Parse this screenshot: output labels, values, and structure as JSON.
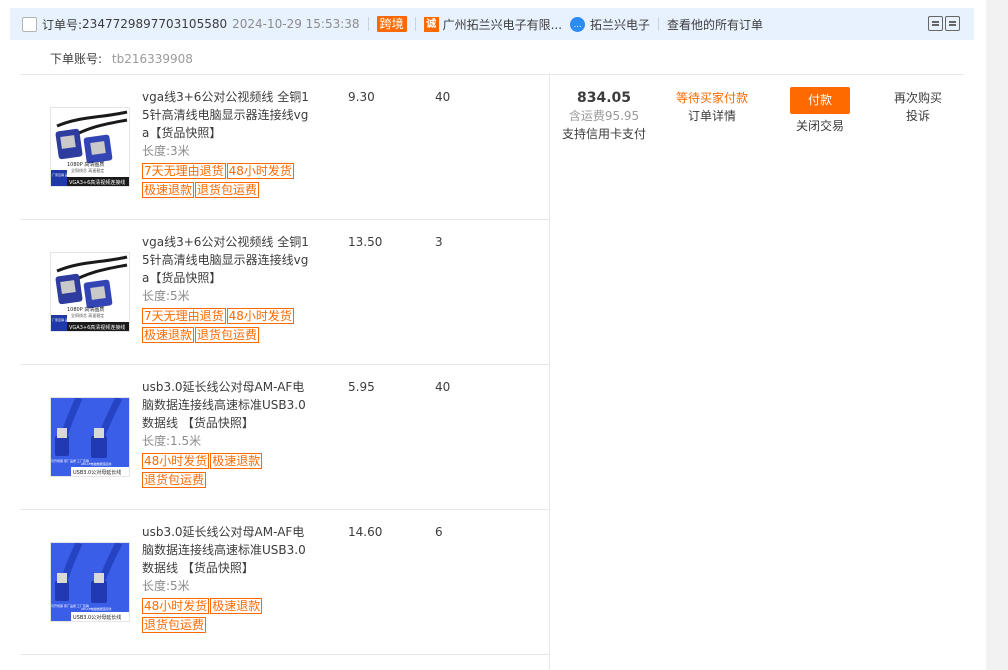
{
  "header": {
    "order_no_label": "订单号:",
    "order_no": "2347729897703105580",
    "order_time": "2024-10-29 15:53:38",
    "crossborder_tag": "跨境",
    "shop_name": "广州拓兰兴电子有限...",
    "chat_name": "拓兰兴电子",
    "all_orders_link": "查看他的所有订单"
  },
  "account": {
    "label": "下单账号:",
    "value": "tb216339908"
  },
  "items": [
    {
      "title": "vga线3+6公对公视频线 全铜15针高清线电脑显示器连接线vga",
      "snapshot": "【货品快照】",
      "spec": "长度:3米",
      "price": "9.30",
      "qty": "40",
      "badges": [
        "7天无理由退货",
        "48小时发货",
        "极速退款",
        "退货包运费"
      ],
      "image_kind": "vga"
    },
    {
      "title": "vga线3+6公对公视频线 全铜15针高清线电脑显示器连接线vga",
      "snapshot": "【货品快照】",
      "spec": "长度:5米",
      "price": "13.50",
      "qty": "3",
      "badges": [
        "7天无理由退货",
        "48小时发货",
        "极速退款",
        "退货包运费"
      ],
      "image_kind": "vga"
    },
    {
      "title": "usb3.0延长线公对母AM-AF电脑数据连接线高速标准USB3.0数据线",
      "snapshot": " 【货品快照】",
      "spec": "长度:1.5米",
      "price": "5.95",
      "qty": "40",
      "badges": [
        "48小时发货",
        "极速退款",
        "退货包运费"
      ],
      "image_kind": "usb"
    },
    {
      "title": "usb3.0延长线公对母AM-AF电脑数据连接线高速标准USB3.0数据线",
      "snapshot": " 【货品快照】",
      "spec": "长度:5米",
      "price": "14.60",
      "qty": "6",
      "badges": [
        "48小时发货",
        "极速退款",
        "退货包运费"
      ],
      "image_kind": "usb"
    }
  ],
  "summary": {
    "total": "834.05",
    "shipping": "含运费95.95",
    "credit": "支持信用卡支付",
    "status": "等待买家付款",
    "detail_link": "订单详情",
    "pay_button": "付款",
    "close_link": "关闭交易",
    "rebuy_link": "再次购买",
    "complain_link": "投诉"
  },
  "images": {
    "vga_line1": "1080P 高清画质",
    "vga_line2": "全铜线芯 高速稳定",
    "vga_caption": "VGA3+6高清视频连接线",
    "vga_side": "厂家直销 品质保证",
    "usb_caption": "USB3.0公对母延长线",
    "usb_side": "可开增票 原厂品质 工厂直销",
    "usb_small": "AM-AF电脑数据连接线"
  },
  "colors": {
    "accent": "#ff6a00",
    "header_bg": "#e8f2ff",
    "chat": "#2b8cf1"
  }
}
